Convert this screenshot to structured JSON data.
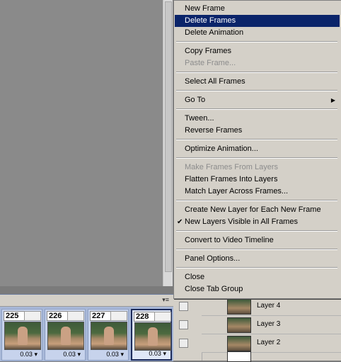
{
  "menu": {
    "items": [
      {
        "label": "New Frame"
      },
      {
        "label": "Delete Frames"
      },
      {
        "label": "Delete Animation"
      },
      {
        "label": "Copy Frames"
      },
      {
        "label": "Paste Frame..."
      },
      {
        "label": "Select All Frames"
      },
      {
        "label": "Go To"
      },
      {
        "label": "Tween..."
      },
      {
        "label": "Reverse Frames"
      },
      {
        "label": "Optimize Animation..."
      },
      {
        "label": "Make Frames From Layers"
      },
      {
        "label": "Flatten Frames Into Layers"
      },
      {
        "label": "Match Layer Across Frames..."
      },
      {
        "label": "Create New Layer for Each New Frame"
      },
      {
        "label": "New Layers Visible in All Frames"
      },
      {
        "label": "Convert to Video Timeline"
      },
      {
        "label": "Panel Options..."
      },
      {
        "label": "Close"
      },
      {
        "label": "Close Tab Group"
      }
    ],
    "check_glyph": "✔",
    "submenu_glyph": "▶"
  },
  "animation": {
    "frames": [
      {
        "number": "225",
        "delay": "0.03"
      },
      {
        "number": "226",
        "delay": "0.03"
      },
      {
        "number": "227",
        "delay": "0.03"
      },
      {
        "number": "228",
        "delay": "0.03"
      }
    ],
    "selected_frame": "228",
    "panel_menu_icon": "▾≡",
    "delay_arrow": "▾"
  },
  "layers": {
    "rows": [
      {
        "name": "Layer 4"
      },
      {
        "name": "Layer 3"
      },
      {
        "name": "Layer 2"
      }
    ]
  },
  "colors": {
    "highlight": "#0a246a",
    "menu_bg": "#d4d0c8",
    "frame_panel_bg": "#a8b8d8"
  }
}
